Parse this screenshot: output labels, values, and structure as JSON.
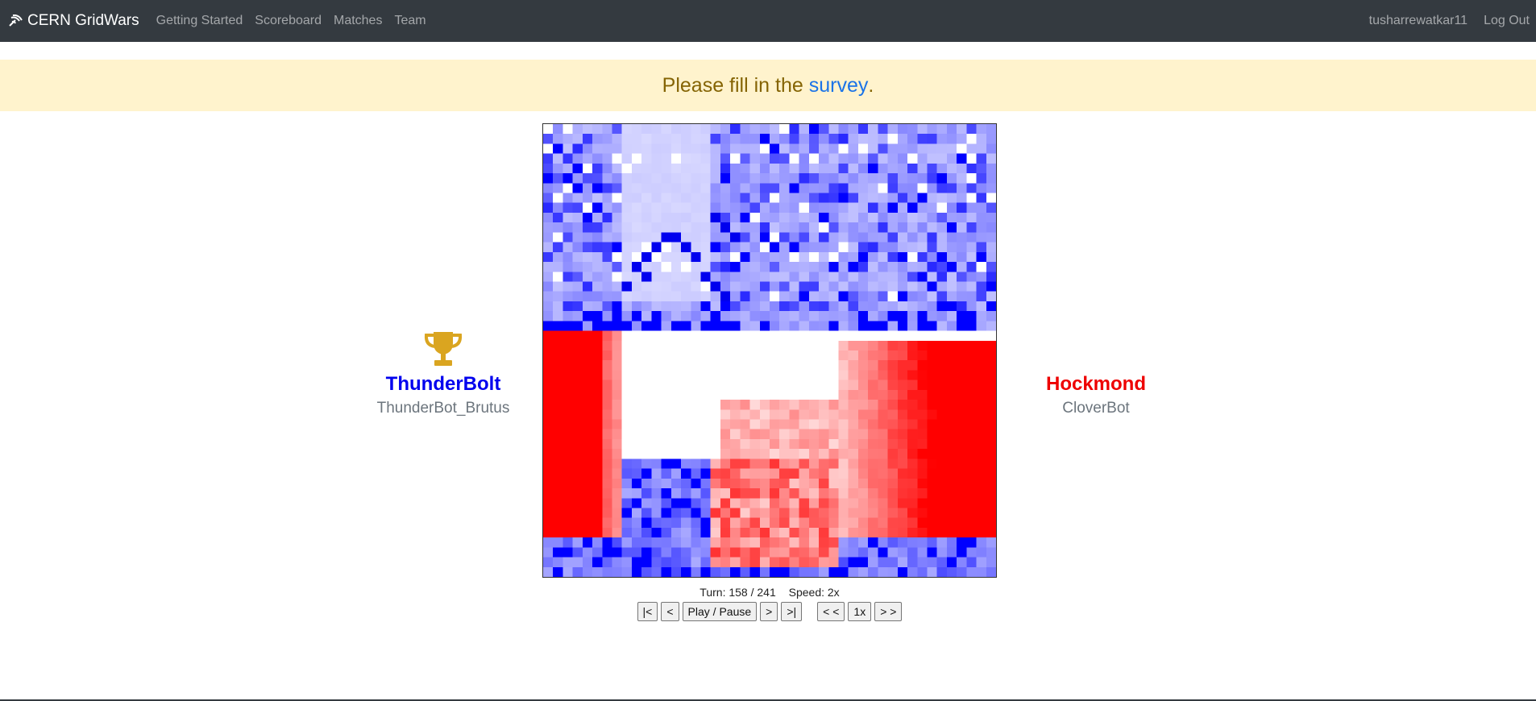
{
  "nav": {
    "brand": "CERN GridWars",
    "brand_icon": "satellite-dish-icon",
    "links": [
      "Getting Started",
      "Scoreboard",
      "Matches",
      "Team"
    ],
    "user": "tusharrewatkar11",
    "logout": "Log Out"
  },
  "banner": {
    "prefix": "Please fill in the ",
    "link": "survey",
    "suffix": "."
  },
  "players": {
    "left": {
      "team": "ThunderBolt",
      "bot": "ThunderBot_Brutus",
      "winner": true,
      "color": "#0000ee",
      "icon": "trophy-icon"
    },
    "right": {
      "team": "Hockmond",
      "bot": "CloverBot",
      "winner": false,
      "color": "#ee0000"
    }
  },
  "game": {
    "turn_label": "Turn: 158 / 241",
    "speed_label": "Speed: 2x",
    "turn": 158,
    "total_turns": 241,
    "speed": "2x",
    "grid_cols": 46,
    "grid_rows": 46
  },
  "controls": {
    "first": "|<",
    "prev": "<",
    "play_pause": "Play / Pause",
    "next": ">",
    "last": ">|",
    "slower": "< <",
    "speed_reset": "1x",
    "faster": "> >"
  },
  "colors": {
    "blue": "#0000ee",
    "red": "#ee0000",
    "navbar": "#343a40",
    "banner_bg": "#fff3cd",
    "banner_text": "#856404",
    "trophy": "#daa520"
  }
}
